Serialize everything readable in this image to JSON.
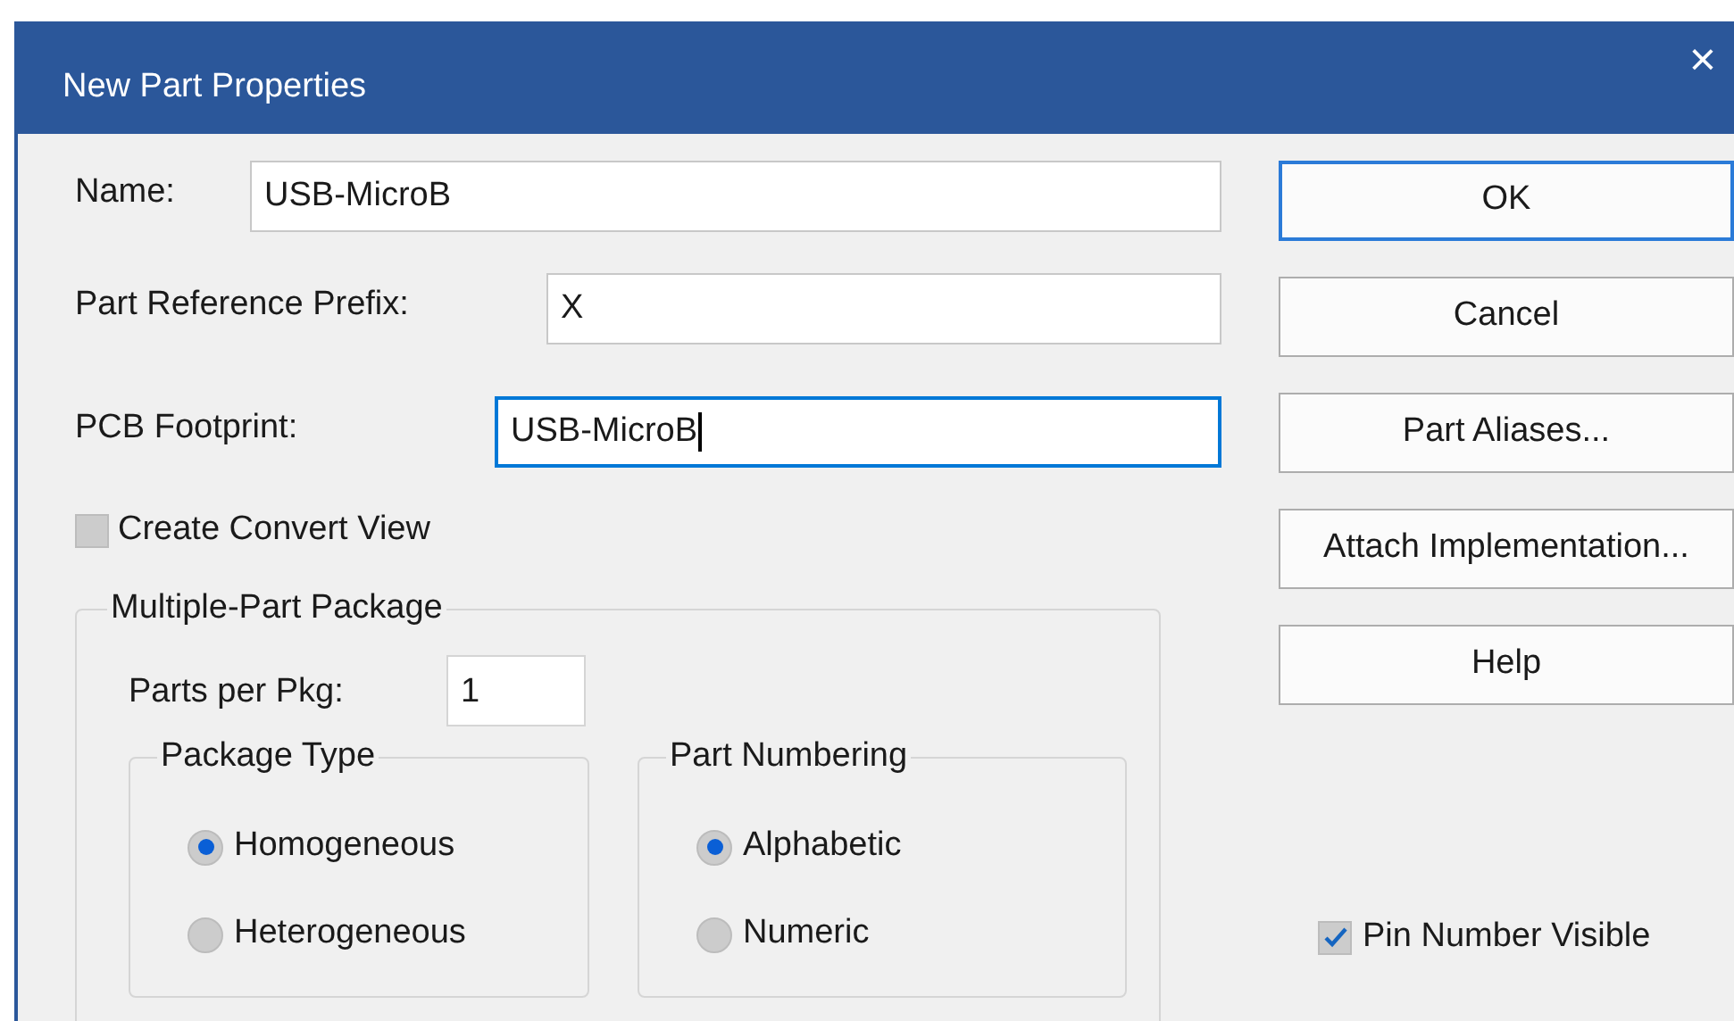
{
  "window": {
    "title": "New Part Properties",
    "close": "×"
  },
  "fields": [
    {
      "label": "Name:",
      "value": "USB-MicroB",
      "focused": false
    },
    {
      "label": "Part Reference Prefix:",
      "value": "X",
      "focused": false
    },
    {
      "label": "PCB Footprint:",
      "value": "USB-MicroB",
      "focused": true
    }
  ],
  "create_convert_view": {
    "label": "Create Convert View",
    "checked": false
  },
  "multiple_part_package": {
    "title": "Multiple-Part Package",
    "parts_per_pkg": {
      "label": "Parts per Pkg:",
      "value": "1"
    },
    "groups": [
      {
        "title": "Package Type",
        "options": [
          {
            "label": "Homogeneous",
            "selected": true
          },
          {
            "label": "Heterogeneous",
            "selected": false
          }
        ]
      },
      {
        "title": "Part Numbering",
        "options": [
          {
            "label": "Alphabetic",
            "selected": true
          },
          {
            "label": "Numeric",
            "selected": false
          }
        ]
      }
    ]
  },
  "buttons": [
    {
      "label": "OK",
      "default": true
    },
    {
      "label": "Cancel",
      "default": false
    },
    {
      "label": "Part Aliases...",
      "default": false
    },
    {
      "label": "Attach Implementation...",
      "default": false
    },
    {
      "label": "Help",
      "default": false
    }
  ],
  "pin_number_visible": {
    "label": "Pin Number Visible",
    "checked": true
  }
}
